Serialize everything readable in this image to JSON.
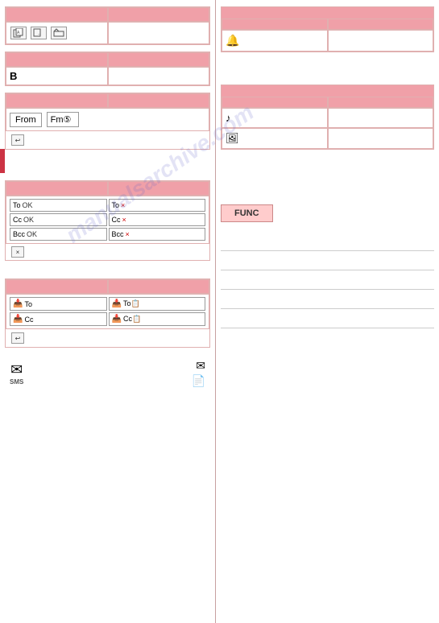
{
  "left": {
    "section1": {
      "header": "",
      "icons": [
        "copy-icon",
        "move-icon",
        "folder-icon"
      ]
    },
    "section2": {
      "header": "",
      "col1_header": "",
      "col2_header": "",
      "col1_body": "B",
      "col2_body": ""
    },
    "from_section": {
      "header": "",
      "from_label": "From",
      "from_value": "Fm⑤",
      "back_icon": "↩"
    },
    "address_section": {
      "header": "",
      "buttons": [
        {
          "label": "To OK",
          "icon": "✓"
        },
        {
          "label": "To ×",
          "icon": "×"
        },
        {
          "label": "Cc OK",
          "icon": "✓"
        },
        {
          "label": "Cc ×",
          "icon": "×"
        },
        {
          "label": "Bcc OK",
          "icon": "✓"
        },
        {
          "label": "Bcc ×",
          "icon": "×"
        }
      ],
      "delete_icon": "×"
    },
    "addr_entry_section": {
      "header": "",
      "buttons": [
        {
          "label": "To",
          "icon": "📋"
        },
        {
          "label": "To📋",
          "icon": ""
        },
        {
          "label": "Cc",
          "icon": "📋"
        },
        {
          "label": "Cc📋",
          "icon": ""
        }
      ],
      "back_icon": "↩"
    },
    "bottom_icons": {
      "sms_label": "SMS",
      "mail_icon": "✉",
      "doc_icon": "📄"
    }
  },
  "right": {
    "section1": {
      "header": "",
      "col1_header": "",
      "col2_header": "",
      "icon": "🔔"
    },
    "section2": {
      "header": "",
      "col1_header": "",
      "col2_header": "",
      "icon1": "♪",
      "icon2": "🖼"
    },
    "func_section": {
      "label": "FUNC"
    },
    "lines": [
      "",
      "",
      "",
      "",
      ""
    ]
  },
  "watermark": "manualsarchive.com"
}
